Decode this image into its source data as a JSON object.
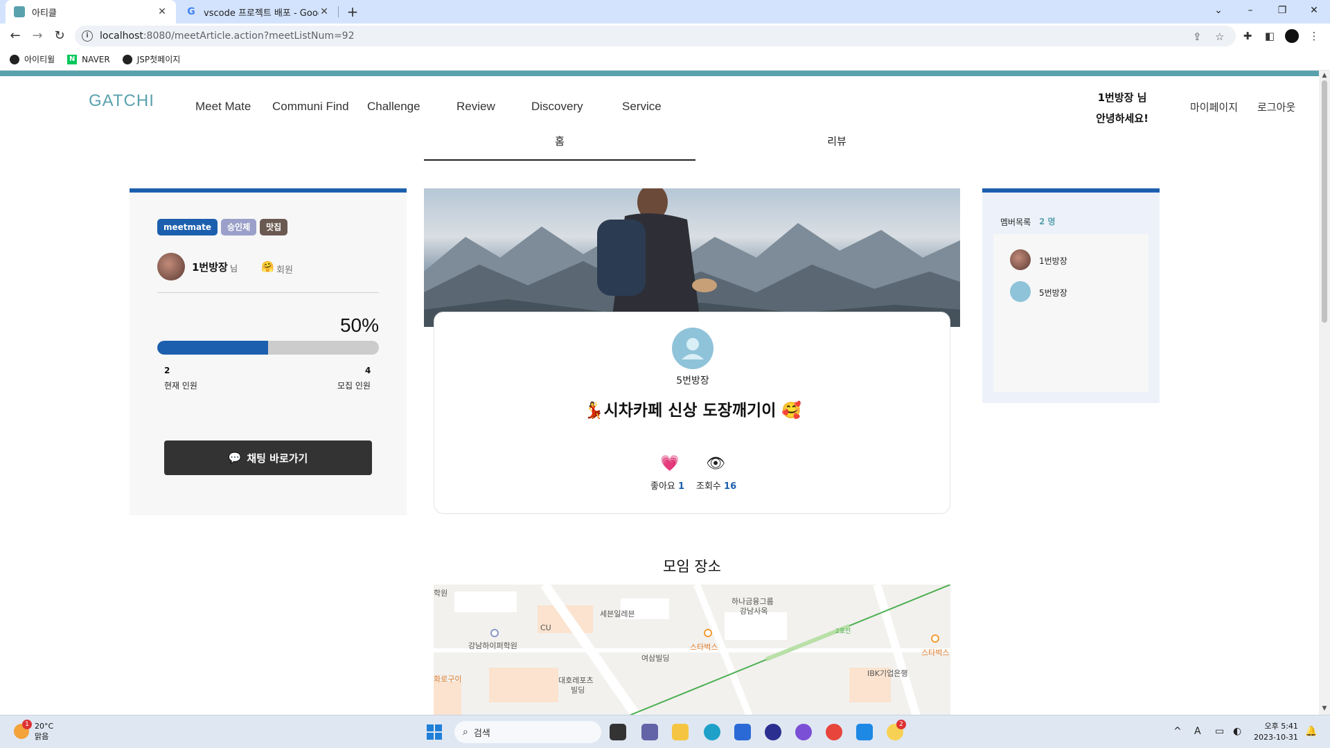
{
  "browser": {
    "tabs": [
      {
        "title": "아티클",
        "active": true
      },
      {
        "title": "vscode 프로젝트 배포 - Google",
        "active": false
      }
    ],
    "url_host": "localhost",
    "url_path": ":8080/meetArticle.action?meetListNum=92",
    "bookmarks": [
      "아이티윌",
      "NAVER",
      "JSP첫페이지"
    ]
  },
  "site": {
    "logo": "GATCHI",
    "nav": [
      "Meet Mate",
      "Communi Find",
      "Challenge",
      "Review",
      "Discovery",
      "Service"
    ],
    "greeting_line1": "1번방장 님",
    "greeting_line2": "안녕하세요!",
    "mypage": "마이페이지",
    "logout": "로그아웃"
  },
  "page_tabs": {
    "home": "홈",
    "review": "리뷰"
  },
  "left": {
    "badges": [
      "meetmate",
      "승인제",
      "맛집"
    ],
    "host_name": "1번방장",
    "host_suffix": "님",
    "member_emoji": "🤗",
    "member_label": "회원",
    "percent_text": "50%",
    "progress": 0.5,
    "current_count": "2",
    "current_label": "현재 인원",
    "max_count": "4",
    "max_label": "모집 인원",
    "chat_icon": "💬",
    "chat_button": "채팅 바로가기"
  },
  "post": {
    "writer": "5번방장",
    "title": "💃시차카페 신상 도장깨기이 🥰",
    "like_icon": "💗",
    "like_label": "좋아요",
    "like_count": "1",
    "view_icon": "👁",
    "view_label": "조회수",
    "view_count": "16",
    "place_title": "모임 장소",
    "map_labels": [
      "학원",
      "세븐일레븐",
      "하나금융그룹",
      "강남사옥",
      "CU",
      "강남하이퍼학원",
      "스타벅스",
      "여삼빌딩",
      "스타벅스",
      "IBK기업은행",
      "대호레포츠",
      "빌딩",
      "화로구이",
      "2호선"
    ]
  },
  "right": {
    "members_head": "멤버목록",
    "members_count": "2 명",
    "members": [
      "1번방장",
      "5번방장"
    ]
  },
  "taskbar": {
    "temp": "20°C",
    "weather": "맑음",
    "weather_badge": "1",
    "search": "검색",
    "time": "오후 5:41",
    "date": "2023-10-31",
    "notify_badge": "2"
  },
  "colors": {
    "accent": "#1c5fae",
    "teal": "#5aa1ae",
    "dark_button": "#333333"
  }
}
